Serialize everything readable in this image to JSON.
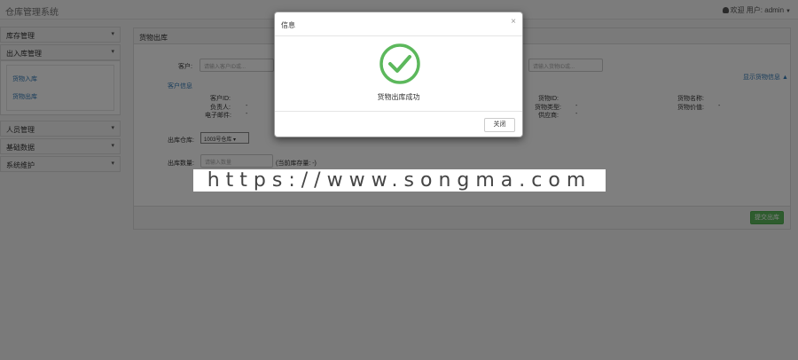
{
  "app": {
    "title": "仓库管理系统"
  },
  "user": {
    "greeting": "欢迎 用户: admin"
  },
  "sidebar": {
    "groups": [
      {
        "label": "库存管理"
      },
      {
        "label": "出入库管理"
      },
      {
        "label": "人员管理"
      },
      {
        "label": "基础数据"
      },
      {
        "label": "系统维护"
      }
    ],
    "sub_items": [
      {
        "label": "货物入库"
      },
      {
        "label": "货物出库"
      }
    ]
  },
  "panel": {
    "title": "货物出库",
    "customer_label": "客户:",
    "customer_placeholder": "请输入客户ID或...",
    "goods_placeholder": "请输入货物ID或...",
    "toggle_link": "显示货物信息",
    "customer_info_title": "客户信息",
    "info_left": {
      "customer_id": "客户ID:",
      "contact": "负责人:",
      "email": "电子邮件:"
    },
    "info_mid": {
      "goods_id": "货物ID:",
      "goods_type": "货物类型:",
      "supplier": "供应商:"
    },
    "info_right": {
      "goods_name": "货物名称:",
      "goods_value": "货物价值:"
    },
    "dash": "-",
    "warehouse_label": "出库仓库:",
    "warehouse_value": "1003号仓库",
    "quantity_label": "出库数量:",
    "quantity_placeholder": "请输入数量",
    "stock_text": "(当前库存量: -)",
    "submit_label": "提交出库"
  },
  "modal": {
    "title": "信息",
    "close_symbol": "×",
    "message": "货物出库成功",
    "close_button": "关闭",
    "success_color": "#5cb85c"
  },
  "watermark": {
    "text": "https://www.songma.com"
  }
}
